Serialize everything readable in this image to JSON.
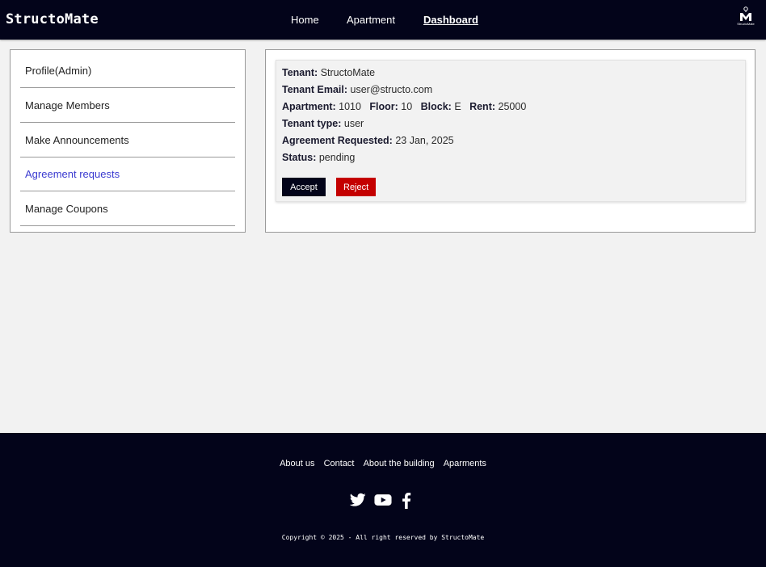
{
  "header": {
    "brand": "StructoMate",
    "nav": [
      {
        "label": "Home"
      },
      {
        "label": "Apartment"
      },
      {
        "label": "Dashboard",
        "active": true
      }
    ],
    "logo_text": "StructoMate",
    "logo_icon": "building-logo-icon"
  },
  "sidebar": {
    "items": [
      {
        "label": "Profile(Admin)"
      },
      {
        "label": "Manage Members"
      },
      {
        "label": "Make Announcements"
      },
      {
        "label": "Agreement requests",
        "active": true
      },
      {
        "label": "Manage Coupons"
      }
    ],
    "active_color": "#3b3bd0"
  },
  "request": {
    "tenant_label": "Tenant:",
    "tenant": "StructoMate",
    "email_label": "Tenant Email:",
    "email": "user@structo.com",
    "apartment_label": "Apartment:",
    "apartment": "1010",
    "floor_label": "Floor:",
    "floor": "10",
    "block_label": "Block:",
    "block": "E",
    "rent_label": "Rent:",
    "rent": "25000",
    "type_label": "Tenant type:",
    "type": "user",
    "requested_label": "Agreement Requested:",
    "requested": "23 Jan, 2025",
    "status_label": "Status:",
    "status": "pending",
    "accept_label": "Accept",
    "reject_label": "Reject"
  },
  "footer": {
    "links": [
      "About us",
      "Contact",
      "About the building",
      "Aparments"
    ],
    "social_icons": [
      "twitter-icon",
      "youtube-icon",
      "facebook-icon"
    ],
    "copyright": "Copyright © 2025 - All right reserved by StructoMate"
  },
  "colors": {
    "header_bg": "#03041a",
    "accept": "#03041a",
    "reject": "#c40000",
    "page_bg": "#f2f2f2"
  }
}
